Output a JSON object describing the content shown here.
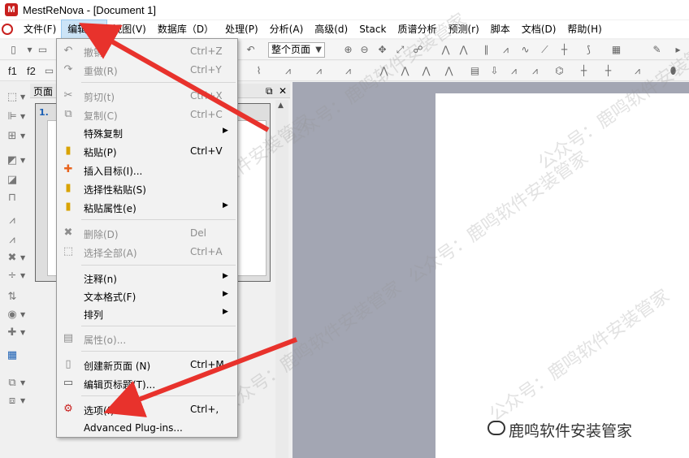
{
  "window": {
    "title": "MestReNova - [Document 1]",
    "logo_letter": "M"
  },
  "menubar": {
    "items": [
      "文件(F)",
      "编辑(E)",
      "视图(V)",
      "数据库（D）",
      "处理(P)",
      "分析(A)",
      "高级(d)",
      "Stack",
      "质谱分析",
      "预测(r)",
      "脚本",
      "文档(D)",
      "帮助(H)"
    ],
    "active_index": 1
  },
  "toolbar": {
    "f1_label": "f1",
    "f2_label": "f2",
    "zoom_select": "整个页面"
  },
  "pages_panel": {
    "title": "页面",
    "page_number": "1."
  },
  "edit_menu": {
    "items": [
      {
        "label": "撤销",
        "shortcut": "Ctrl+Z",
        "icon": "undo-icon",
        "disabled": true
      },
      {
        "label": "重做(R)",
        "shortcut": "Ctrl+Y",
        "icon": "redo-icon",
        "disabled": true
      },
      {
        "label": "剪切(t)",
        "shortcut": "Ctrl+X",
        "icon": "scissors-icon",
        "disabled": true
      },
      {
        "label": "复制(C)",
        "shortcut": "Ctrl+C",
        "icon": "copy-icon",
        "disabled": true
      },
      {
        "label": "特殊复制",
        "shortcut": "",
        "icon": "",
        "disabled": false,
        "submenu": true
      },
      {
        "label": "粘贴(P)",
        "shortcut": "Ctrl+V",
        "icon": "paste-icon",
        "disabled": false
      },
      {
        "label": "插入目标(I)...",
        "shortcut": "",
        "icon": "puzzle-icon",
        "disabled": false
      },
      {
        "label": "选择性粘贴(S)",
        "shortcut": "",
        "icon": "paste-special-icon",
        "disabled": false
      },
      {
        "label": "粘贴属性(e)",
        "shortcut": "",
        "icon": "paste-properties-icon",
        "disabled": false,
        "submenu": true
      },
      {
        "label": "删除(D)",
        "shortcut": "Del",
        "icon": "delete-icon",
        "disabled": true
      },
      {
        "label": "选择全部(A)",
        "shortcut": "Ctrl+A",
        "icon": "select-all-icon",
        "disabled": true
      },
      {
        "label": "注释(n)",
        "shortcut": "",
        "icon": "",
        "disabled": false,
        "submenu": true
      },
      {
        "label": "文本格式(F)",
        "shortcut": "",
        "icon": "",
        "disabled": false,
        "submenu": true
      },
      {
        "label": "排列",
        "shortcut": "",
        "icon": "",
        "disabled": false,
        "submenu": true
      },
      {
        "label": "属性(o)...",
        "shortcut": "",
        "icon": "properties-icon",
        "disabled": true
      },
      {
        "label": "创建新页面 (N)",
        "shortcut": "Ctrl+M",
        "icon": "new-page-icon",
        "disabled": false
      },
      {
        "label": "编辑页标题(T)...",
        "shortcut": "",
        "icon": "page-title-icon",
        "disabled": false
      },
      {
        "label": "选项(f)...",
        "shortcut": "Ctrl+,",
        "icon": "gear-icon",
        "disabled": false
      },
      {
        "label": "Advanced Plug-ins...",
        "shortcut": "",
        "icon": "",
        "disabled": false
      }
    ]
  },
  "watermark": {
    "text": "公众号：鹿鸣软件安装管家",
    "brand": "鹿鸣软件安装管家"
  },
  "colors": {
    "arrow": "#e8322c",
    "menu_highlight": "#cce4f7",
    "workspace": "#a3a6b3",
    "accent_red": "#c8201e"
  }
}
